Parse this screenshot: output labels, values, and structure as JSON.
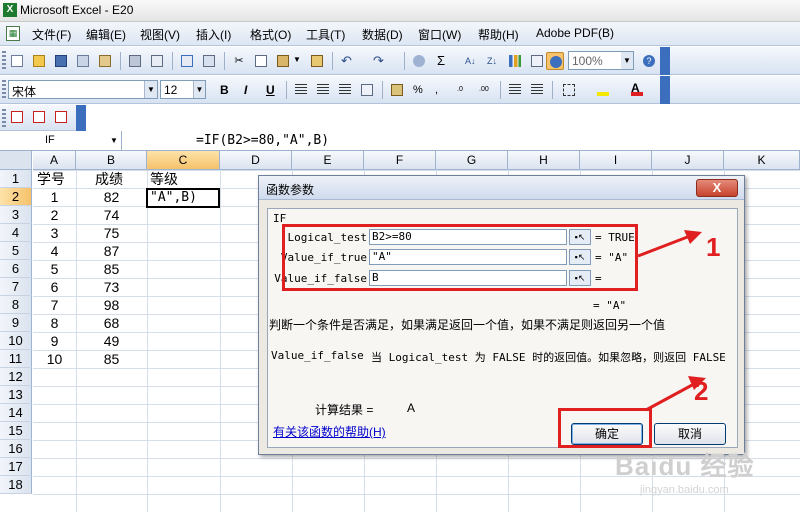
{
  "window": {
    "title": "Microsoft Excel - E20"
  },
  "menu": [
    "文件(F)",
    "编辑(E)",
    "视图(V)",
    "插入(I)",
    "格式(O)",
    "工具(T)",
    "数据(D)",
    "窗口(W)",
    "帮助(H)",
    "Adobe PDF(B)"
  ],
  "toolbar": {
    "font_name": "宋体",
    "font_size": "12",
    "zoom": "100%",
    "bold": "B",
    "italic": "I",
    "underline": "U"
  },
  "formula_bar": {
    "name_box": "IF",
    "formula": "=IF(B2>=80,\"A\",B)"
  },
  "columns": [
    "A",
    "B",
    "C",
    "D",
    "E",
    "F",
    "G",
    "H",
    "I",
    "J",
    "K"
  ],
  "rows": [
    "1",
    "2",
    "3",
    "4",
    "5",
    "6",
    "7",
    "8",
    "9",
    "10",
    "11",
    "12",
    "13",
    "14",
    "15",
    "16",
    "17",
    "18"
  ],
  "sheet": {
    "headers": {
      "a": "学号",
      "b": "成绩",
      "c": "等级"
    },
    "data": [
      {
        "a": "1",
        "b": "82"
      },
      {
        "a": "2",
        "b": "74"
      },
      {
        "a": "3",
        "b": "75"
      },
      {
        "a": "4",
        "b": "87"
      },
      {
        "a": "5",
        "b": "85"
      },
      {
        "a": "6",
        "b": "73"
      },
      {
        "a": "7",
        "b": "98"
      },
      {
        "a": "8",
        "b": "68"
      },
      {
        "a": "9",
        "b": "49"
      },
      {
        "a": "10",
        "b": "85"
      }
    ],
    "active_cell_text": "\"A\",B)"
  },
  "dialog": {
    "title": "函数参数",
    "close": "X",
    "function": "IF",
    "args": [
      {
        "label": "Logical_test",
        "value": "B2>=80",
        "result": "= TRUE"
      },
      {
        "label": "Value_if_true",
        "value": "\"A\"",
        "result": "= \"A\""
      },
      {
        "label": "Value_if_false",
        "value": "B",
        "result": "="
      }
    ],
    "overall_result": "= \"A\"",
    "description": "判断一个条件是否满足，如果满足返回一个值，如果不满足则返回另一个值",
    "arg_help_name": "Value_if_false",
    "arg_help_text": "当 Logical_test 为 FALSE 时的返回值。如果忽略，则返回 FALSE",
    "calc_label": "计算结果 =",
    "calc_value": "A",
    "help_link": "有关该函数的帮助(H)",
    "ok": "确定",
    "cancel": "取消"
  },
  "annotations": [
    "1",
    "2"
  ],
  "watermark": {
    "brand": "Baidu 经验",
    "url": "jingyan.baidu.com"
  },
  "colors": {
    "annotation_red": "#e02020",
    "toolbar_blue": "#3b6fbd",
    "header_active": "#f6c26b"
  }
}
